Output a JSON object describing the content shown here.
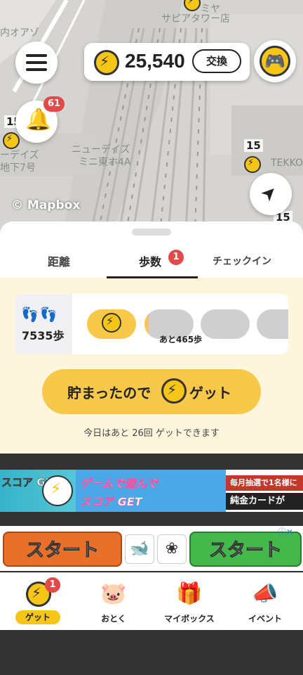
{
  "map": {
    "labels": [
      "ミヤ",
      "サピアタワー店",
      "内オアゾ",
      "ニューデイズ",
      "ミニ東ホ4A",
      "ーデイズ",
      "地下7号",
      "TEKKO"
    ],
    "numbers": [
      "15",
      "15",
      "15"
    ],
    "attribution": "© Mapbox"
  },
  "header": {
    "balance": "25,540",
    "exchange_label": "交換"
  },
  "notifications": {
    "count": "61"
  },
  "tabs": [
    {
      "label": "距離"
    },
    {
      "label": "歩数",
      "badge": "1"
    },
    {
      "label": "チェックイン"
    }
  ],
  "steps": {
    "count": "7535歩",
    "remaining": "あと465歩"
  },
  "get_button": {
    "label_before": "貯まったので",
    "label_after": "ゲット"
  },
  "remaining_text": "今日はあと 26回 ゲットできます",
  "ads": {
    "banner1": {
      "left_text": "スコア GET!",
      "mid_line1": "ゲームで遊んで",
      "mid_line2": "スコア GET",
      "right_line1": "毎月抽選で1名様に",
      "right_line2": "純金カードが"
    },
    "banner2": {
      "button_label": "スタート",
      "info_icon": "ⓘ✕"
    }
  },
  "bottom_nav": [
    {
      "label": "ゲット",
      "badge": "1",
      "icon": "coin-icon"
    },
    {
      "label": "おとく",
      "icon": "piggy-bank-icon"
    },
    {
      "label": "マイボックス",
      "icon": "gift-box-icon"
    },
    {
      "label": "イベント",
      "icon": "megaphone-icon"
    }
  ],
  "colors": {
    "accent": "#f5c518",
    "badge": "#e24a4a",
    "sheet_bg": "#fdf5dc"
  }
}
